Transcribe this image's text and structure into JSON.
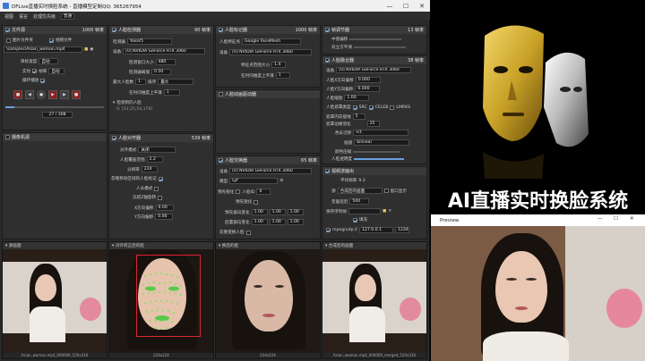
{
  "window": {
    "title": "DFLive直播实时换脸系统 - 直播模型定制QQ: 365267954",
    "minimize": "—",
    "maximize": "☐",
    "close": "✕"
  },
  "menu": [
    "视图",
    "语言",
    "处理优先级",
    "普通"
  ],
  "file_source": {
    "title": "文件源",
    "fps": "1000 帧率",
    "image_folder": "图片文件夹",
    "video_file": "视频文件",
    "path": "\\samples\\Asian_woman.mp4",
    "target_width_label": "目标宽度",
    "target_width": "自动",
    "realtime_label": "实时",
    "realtime_value": "帧率",
    "frame_label": "自动",
    "loop_label": "循环播放",
    "frame_counter": "27 / 308"
  },
  "face_detector": {
    "title": "人脸检测器",
    "fps": "90 帧率",
    "detector_label": "检测器",
    "detector": "YoloV5",
    "device_label": "设备",
    "device": "[0] NVIDIA GeForce RTX 3060",
    "window_size_label": "检测窗口大小",
    "window_size": "480",
    "threshold_label": "检测器阈值",
    "threshold": "0.50",
    "max_faces_label": "最大人脸数",
    "max_faces": "1",
    "sort_label": "排序",
    "sort": "最大",
    "time_smooth_label": "在时间维度上平滑",
    "time_smooth": "1",
    "detected_label": "检测到的人脸",
    "detected_value": "0: [53,25,54,178]"
  },
  "face_marker": {
    "title": "人脸标记器",
    "fps": "1000 帧率",
    "marker_label": "人脸特征点",
    "marker": "Google FaceMesh",
    "device_label": "设备",
    "device": "[0] NVIDIA GeForce RTX 3060",
    "range_label": "特征点范围大小",
    "range": "1.4",
    "smooth_label": "在时间维度上平滑",
    "smooth": "1"
  },
  "face_aligner": {
    "title": "人脸对齐器",
    "fps": "539 帧率",
    "mode_label": "对齐模式",
    "mode": "关闭",
    "coverage_label": "人脸覆盖范围",
    "coverage": "2.2",
    "resolution_label": "分辨率",
    "resolution": "224",
    "exclude_label": "忽略移动区域的人脸标记",
    "head_label": "人头模式",
    "freeze_label": "冻结Z轴旋转",
    "x_offset_label": "X方向偏移",
    "x_offset": "0.00",
    "y_offset_label": "Y方向偏移",
    "y_offset": "0.00"
  },
  "face_animator": {
    "title": "人脸动画驱动器"
  },
  "face_swapper": {
    "title": "人脸交换器",
    "fps": "65 帧率",
    "device_label": "设备",
    "device": "[0] NVIDIA GeForce RTX 3060",
    "model_label": "模型",
    "model": "Lyf",
    "face_id_label": "人脸ID",
    "face_id": "0",
    "morph_label": "预先锐化",
    "presharp_label": "预先锐化",
    "gamma_label": "预先伽马变化",
    "gamma_value": "1.00",
    "post_gamma_label": "后置伽马变化",
    "post_gamma_value": "1.00",
    "two_pass_label": "双重变换人脸"
  },
  "stream_out": {
    "title": "帧调节器",
    "fps": "13 帧率",
    "mid_shift_label": "中值偏移",
    "downscale_label": "双立方平滑"
  },
  "face_merger": {
    "title": "人脸融合器",
    "fps": "38 帧率",
    "device_label": "设备",
    "device": "[0] NVIDIA GeForce RTX 3060",
    "x_offset_label": "人脸X方向偏移",
    "x_offset": "0.000",
    "y_offset_label": "人脸Y方向偏移",
    "y_offset": "0.000",
    "scale_label": "人脸缩放",
    "scale": "1.00",
    "mask_label": "人脸遮罩类型",
    "mask_src": "SRC",
    "mask_celeb": "CELEB",
    "mask_lmrks": "LMRKS",
    "erode_label": "遮罩内向侵蚀",
    "erode": "5",
    "blur_label": "遮罩边缘羽化",
    "blur": "25",
    "color_transfer_label": "色彩迁移",
    "color_transfer": "rct",
    "interp_label": "插值",
    "interp": "bilinear",
    "color_compress_label": "颜色压缩",
    "opacity_label": "人脸透明度"
  },
  "stream_output": {
    "title": "视频流输出",
    "avg_fps_label": "平均帧率",
    "avg_fps": "9.3",
    "source_label": "源",
    "source": "合成后的画面",
    "window_label": "窗口显示",
    "save_path_label": "保存序列帧",
    "fill_label": "填充",
    "mpeg_label": "mpeg/udp://",
    "mpeg_host": "127.0.0.1",
    "mpeg_port": "1234",
    "delay_label": "音画延迟",
    "delay": "500"
  },
  "camera_source": {
    "title": "摄像机源"
  },
  "previews": {
    "source": "源画面",
    "aligned": "对齐校正后的脸",
    "swapped": "换后的脸",
    "merged": "合成后的画面",
    "source_foot": "Asian_woman.mp4_000009_520x316",
    "aligned_foot": "224x224",
    "swapped_foot": "224x224",
    "merged_foot": "Asian_woman.mp4_000009_merged_520x316"
  },
  "promo": {
    "headline": "AI直播实时换脸系统"
  },
  "preview_window": {
    "title": "Preview",
    "minimize": "—",
    "maximize": "☐",
    "close": "✕"
  },
  "colors": {
    "panel": "#2f2f2f",
    "header": "#3a3a3a",
    "accent": "#3a7bd5",
    "mask_gold": "#c9a227",
    "mask_silver": "#c8c8c8"
  }
}
